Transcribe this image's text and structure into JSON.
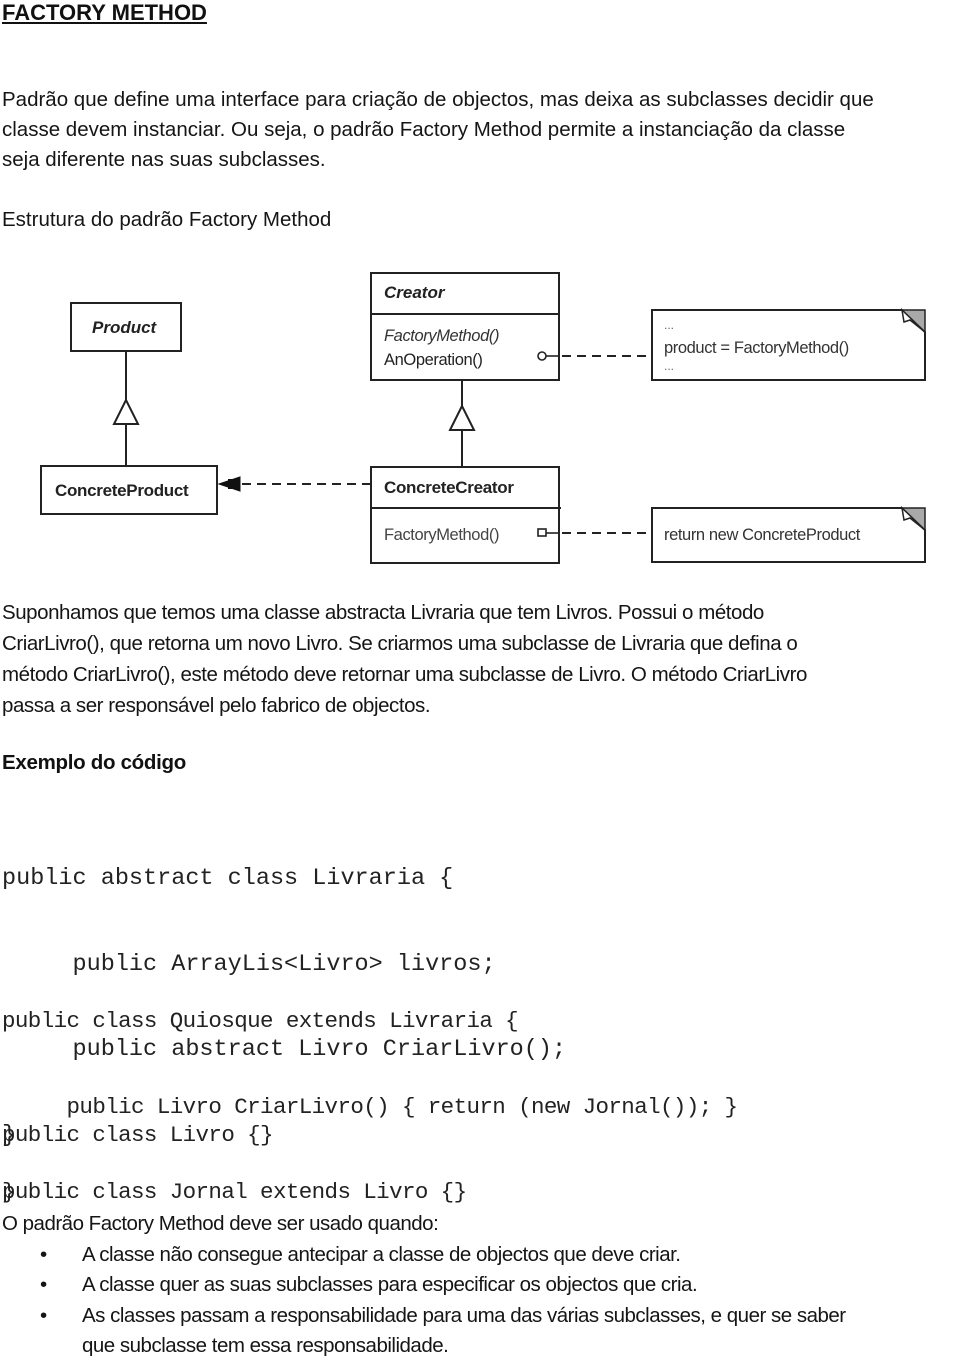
{
  "document": {
    "title": "FACTORY METHOD",
    "intro_lines": [
      "Padrão que define uma interface para criação de objectos, mas deixa as subclasses decidir que",
      "classe devem instanciar. Ou seja, o padrão Factory Method permite a instanciação da classe",
      "seja diferente nas suas subclasses."
    ],
    "structure_heading": "Estrutura do padrão Factory Method",
    "diagram": {
      "product": {
        "name": "Product"
      },
      "concrete_product": {
        "name": "ConcreteProduct"
      },
      "creator": {
        "name": "Creator",
        "methods": [
          "FactoryMethod()",
          "AnOperation()"
        ]
      },
      "concrete_creator": {
        "name": "ConcreteCreator",
        "methods": [
          "FactoryMethod()"
        ]
      },
      "note_creator": [
        "...",
        "product = FactoryMethod()",
        "..."
      ],
      "note_concrete_creator": "return new ConcreteProduct"
    },
    "explanation_lines": [
      "Suponhamos que temos uma classe abstracta Livraria que tem Livros. Possui o método",
      "CriarLivro(), que retorna um novo Livro. Se criarmos uma subclasse de Livraria que defina o",
      "método CriarLivro(), este método deve retornar uma subclasse de Livro. O método CriarLivro",
      "passa a ser responsável pelo fabrico de objectos."
    ],
    "code_heading": "Exemplo do código",
    "code_block_1": [
      "public abstract class Livraria {",
      "     public ArrayLis<Livro> livros;",
      "     public abstract Livro CriarLivro();",
      "}"
    ],
    "code_block_2": [
      "public class Quiosque extends Livraria {",
      "     public Livro CriarLivro() { return (new Jornal()); }",
      "}"
    ],
    "code_block_3": [
      "public class Livro {}"
    ],
    "code_block_4": [
      "public class Jornal extends Livro {}"
    ],
    "usage_intro": "O padrão Factory Method deve ser usado quando:",
    "usage_bullet_glyph": "•",
    "usage_items": [
      {
        "text": "A classe não consegue antecipar a classe de objectos que deve criar."
      },
      {
        "text": "A classe quer as suas subclasses para especificar os objectos que cria."
      },
      {
        "text": "As classes passam a responsabilidade para uma das várias subclasses, e quer se saber",
        "continuation": "que subclasse tem essa responsabilidade."
      }
    ]
  }
}
